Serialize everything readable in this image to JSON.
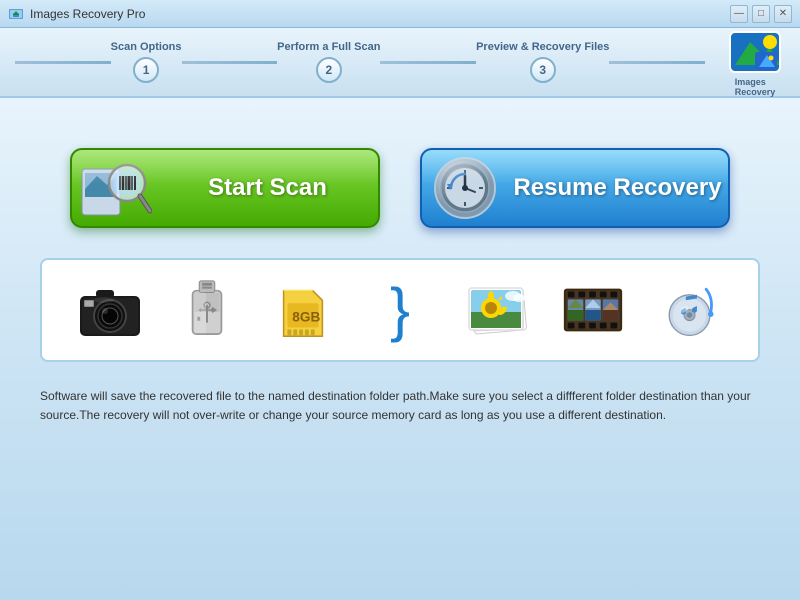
{
  "titleBar": {
    "title": "Images Recovery Pro",
    "controls": {
      "minimize": "—",
      "maximize": "□",
      "close": "✕"
    }
  },
  "steps": [
    {
      "label": "Scan Options",
      "number": "1"
    },
    {
      "label": "Perform a Full Scan",
      "number": "2"
    },
    {
      "label": "Preview & Recovery Files",
      "number": "3"
    }
  ],
  "logo": {
    "alt": "Images Recovery"
  },
  "buttons": {
    "startScan": "Start Scan",
    "resumeRecovery": "Resume Recovery"
  },
  "infoText": "Software will save the recovered file to the named destination folder path.Make sure you select a diffferent folder destination than your source.The recovery will not over-write or change your source memory card as long as you use a different destination."
}
